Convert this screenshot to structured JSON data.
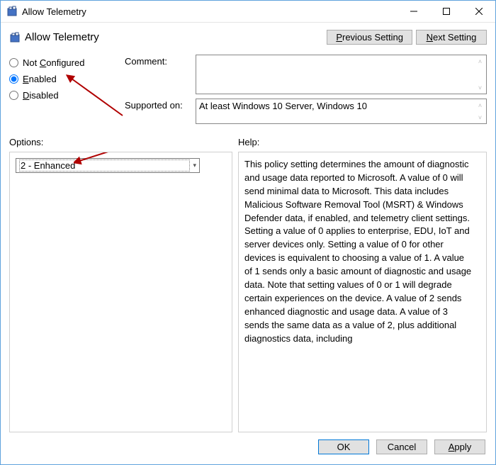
{
  "window": {
    "title": "Allow Telemetry"
  },
  "header": {
    "title": "Allow Telemetry",
    "prev_button": "Previous Setting",
    "next_button": "Next Setting",
    "prev_hint": "P",
    "next_hint": "N"
  },
  "state": {
    "not_configured": "Not Configured",
    "enabled": "Enabled",
    "disabled": "Disabled",
    "nc_hint": "C",
    "en_hint": "E",
    "dis_hint": "D",
    "selected": "enabled"
  },
  "comment": {
    "label": "Comment:",
    "value": ""
  },
  "supported": {
    "label": "Supported on:",
    "value": "At least Windows 10 Server, Windows 10"
  },
  "options": {
    "label": "Options:",
    "dropdown_value": "2 - Enhanced"
  },
  "help": {
    "label": "Help:",
    "text": "This policy setting determines the amount of diagnostic and usage data reported to Microsoft. A value of 0 will send minimal data to Microsoft. This data includes Malicious Software Removal Tool (MSRT) & Windows Defender data, if enabled, and telemetry client settings. Setting a value of 0 applies to enterprise, EDU, IoT and server devices only. Setting a value of 0 for other devices is equivalent to choosing a value of 1. A value of 1 sends only a basic amount of diagnostic and usage data. Note that setting values of 0 or 1 will degrade certain experiences on the device. A value of 2 sends enhanced diagnostic and usage data. A value of 3 sends the same data as a value of 2, plus additional diagnostics data, including"
  },
  "footer": {
    "ok": "OK",
    "cancel": "Cancel",
    "apply": "Apply",
    "apply_hint": "A"
  }
}
